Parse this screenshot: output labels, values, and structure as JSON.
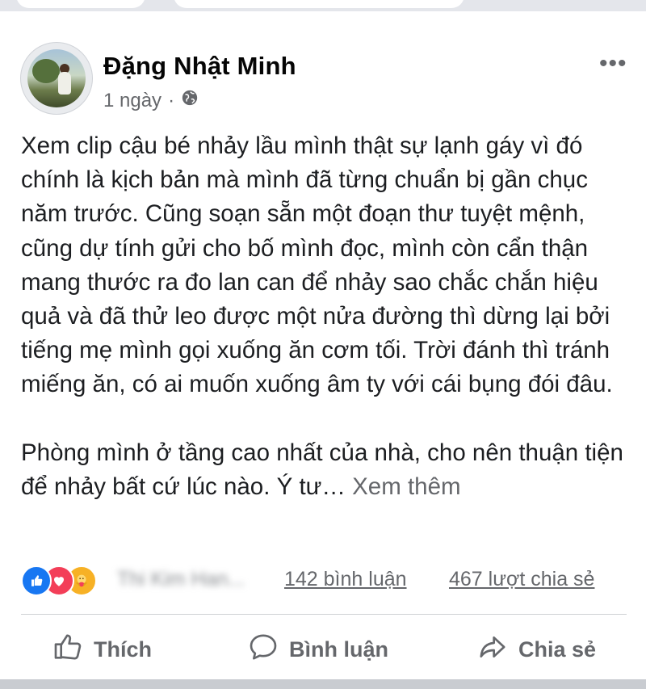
{
  "post": {
    "author": "Đặng Nhật Minh",
    "time": "1 ngày",
    "separator": "·",
    "more_menu": "•••",
    "paragraphs": [
      "Xem clip cậu bé nhảy lầu mình thật sự lạnh gáy vì đó chính là kịch bản mà mình đã từng chuẩn bị gần chục năm trước. Cũng soạn sẵn một đoạn thư tuyệt mệnh, cũng dự tính gửi cho bố mình đọc, mình còn cẩn thận mang thước ra đo lan can để nhảy sao chắc chắn hiệu quả và đã thử leo được một nửa đường thì dừng lại bởi tiếng mẹ mình gọi xuống ăn cơm tối. Trời đánh thì tránh miếng ăn, có ai muốn xuống âm ty với cái bụng đói đâu.",
      "Phòng mình ở tầng cao nhất của nhà, cho nên thuận tiện để nhảy bất cứ lúc nào. Ý tư…"
    ],
    "see_more": "Xem thêm"
  },
  "stats": {
    "reactors_blurred": "Thi Kim Han...",
    "comments": "142 bình luận",
    "shares": "467 lượt chia sẻ"
  },
  "actions": {
    "like": "Thích",
    "comment": "Bình luận",
    "share": "Chia sẻ"
  },
  "icons": {
    "like_reaction": "like-reaction-icon",
    "love_reaction": "love-reaction-icon",
    "care_reaction": "care-reaction-icon",
    "globe": "globe-icon",
    "like": "thumbs-up-icon",
    "comment": "comment-bubble-icon",
    "share": "share-arrow-icon"
  },
  "colors": {
    "text": "#1c1e21",
    "secondary": "#65676b",
    "like_blue": "#1877f2",
    "love_red": "#f33e58",
    "care_yellow": "#f7b125"
  }
}
